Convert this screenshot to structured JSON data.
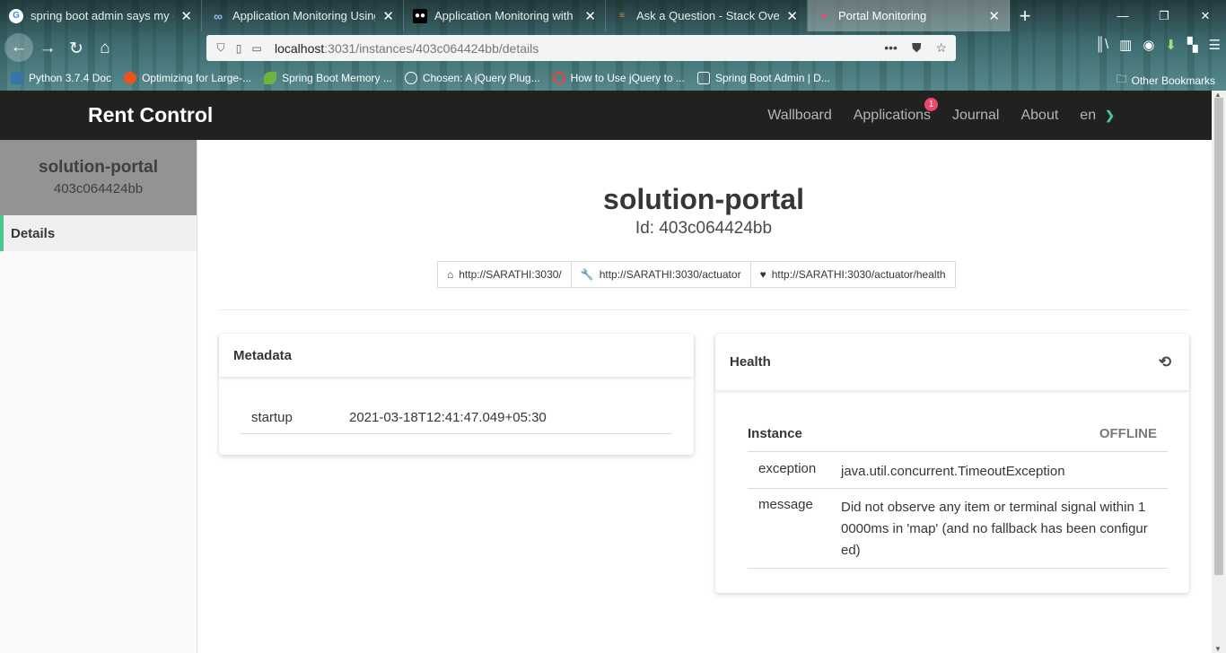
{
  "browser": {
    "tabs": [
      {
        "title": "spring boot admin says my clie",
        "icon": "google-icon",
        "color": "#ffffff"
      },
      {
        "title": "Application Monitoring Using",
        "icon": "infinity-icon",
        "color": "#3c5aa8"
      },
      {
        "title": "Application Monitoring with P",
        "icon": "medium-icon",
        "color": "#000000"
      },
      {
        "title": "Ask a Question - Stack Overflo",
        "icon": "stackoverflow-icon",
        "color": "#f48024"
      },
      {
        "title": "Portal Monitoring",
        "icon": "pulse-icon",
        "color": "#f14668",
        "active": true
      }
    ],
    "url_host": "localhost",
    "url_rest": ":3031/instances/403c064424bb/details",
    "bookmarks": [
      {
        "label": "Python 3.7.4 Doc",
        "icon": "python-icon",
        "color": "#3776ab"
      },
      {
        "label": "Optimizing for Large-...",
        "icon": "ubuntu-icon",
        "color": "#e95420"
      },
      {
        "label": "Spring Boot Memory ...",
        "icon": "leaf-icon",
        "color": "#6db33f"
      },
      {
        "label": "Chosen: A jQuery Plug...",
        "icon": "globe-icon",
        "color": "#ffffff"
      },
      {
        "label": "How to Use jQuery to ...",
        "icon": "infinity-icon",
        "color": "#e8453c"
      },
      {
        "label": "Spring Boot Admin | D...",
        "icon": "code-icon",
        "color": "#ffffff"
      }
    ],
    "other_bookmarks": "Other Bookmarks"
  },
  "app": {
    "brand": "Rent Control",
    "nav": [
      {
        "label": "Wallboard"
      },
      {
        "label": "Applications",
        "badge": "1"
      },
      {
        "label": "Journal"
      },
      {
        "label": "About"
      },
      {
        "label": "en"
      }
    ]
  },
  "sidebar": {
    "name": "solution-portal",
    "id": "403c064424bb",
    "items": [
      {
        "label": "Details"
      }
    ]
  },
  "main": {
    "title": "solution-portal",
    "subtitle": "Id: 403c064424bb",
    "links": [
      {
        "label": "http://SARATHI:3030/",
        "icon": "home-icon"
      },
      {
        "label": "http://SARATHI:3030/actuator",
        "icon": "wrench-icon"
      },
      {
        "label": "http://SARATHI:3030/actuator/health",
        "icon": "heartbeat-icon"
      }
    ]
  },
  "metadata": {
    "title": "Metadata",
    "rows": [
      {
        "key": "startup",
        "value": "2021-03-18T12:41:47.049+05:30"
      }
    ]
  },
  "health": {
    "title": "Health",
    "instance_label": "Instance",
    "status": "OFFLINE",
    "rows": [
      {
        "key": "exception",
        "value": "java.util.concurrent.TimeoutException"
      },
      {
        "key": "message",
        "value": "Did not observe any item or terminal signal within 10000ms in 'map' (and no fallback has been configured)"
      }
    ]
  },
  "colors": {
    "accent": "#48c78e",
    "badge": "#f14668",
    "appbar": "#212121"
  }
}
